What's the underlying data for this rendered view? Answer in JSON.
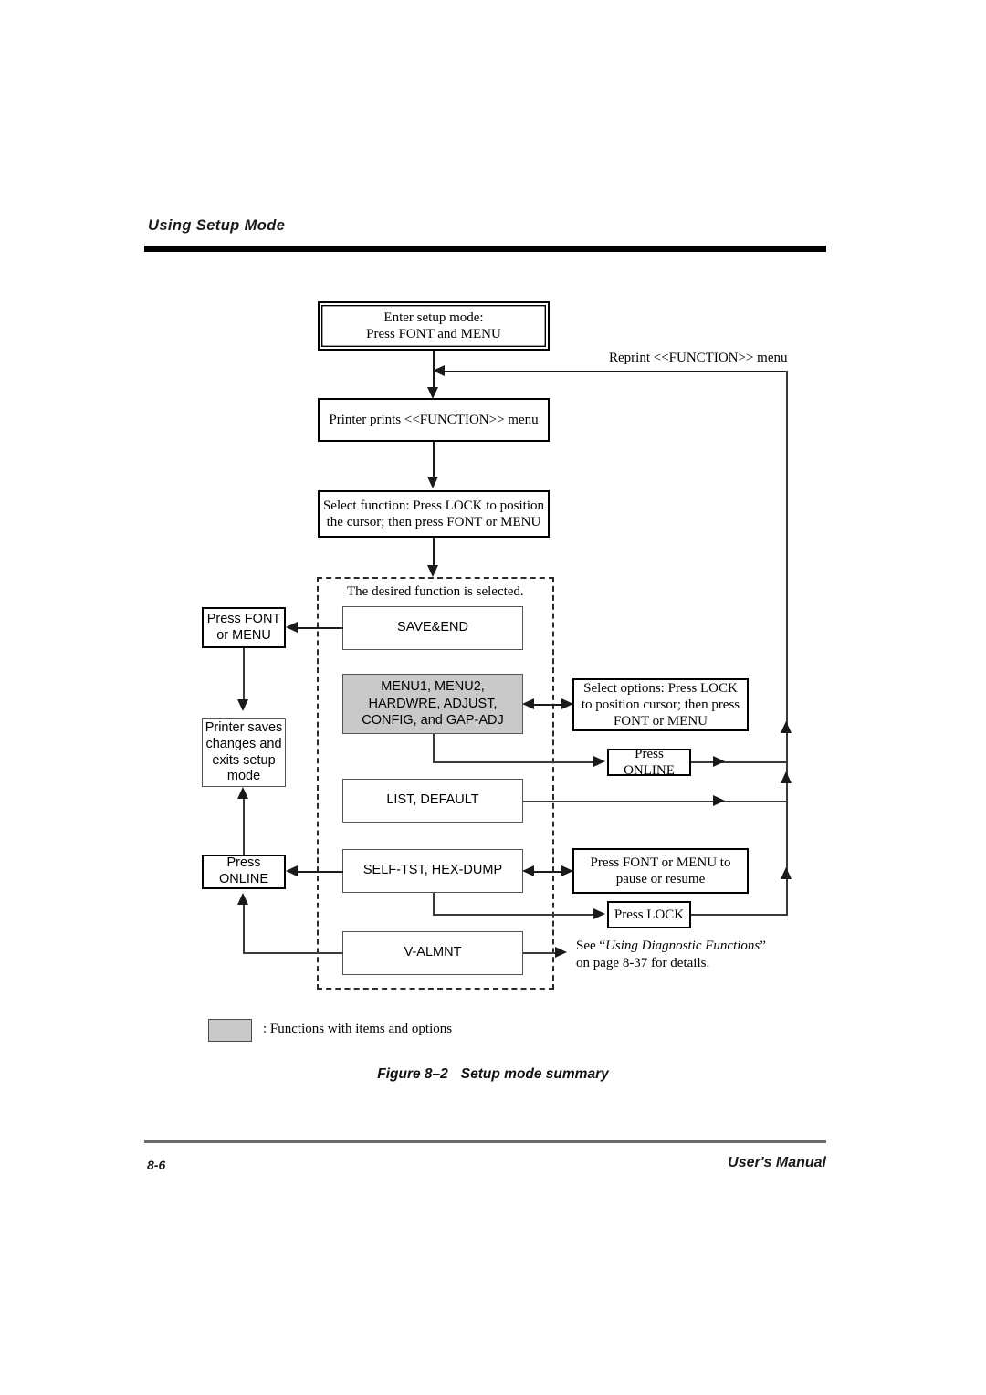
{
  "header": {
    "title": "Using Setup Mode"
  },
  "footer": {
    "page_number": "8-6",
    "manual_label": "User's Manual"
  },
  "caption": {
    "figure_number": "Figure 8–2",
    "figure_title": "Setup mode summary"
  },
  "legend": {
    "symbol": "gray-filled-box",
    "text": ": Functions with items and options"
  },
  "flowchart": {
    "enter_setup": "Enter setup mode:\nPress FONT and MENU",
    "printer_prints": "Printer prints <<FUNCTION>> menu",
    "select_function": "Select function: Press LOCK to position\nthe cursor; then press FONT or MENU",
    "reprint_label": "Reprint <<FUNCTION>> menu",
    "desired_function": "The desired function is selected.",
    "functions": [
      {
        "name": "SAVE&END",
        "style": "plain"
      },
      {
        "name": "MENU1, MENU2,\nHARDWRE, ADJUST,\nCONFIG, and GAP-ADJ",
        "style": "gray"
      },
      {
        "name": "LIST, DEFAULT",
        "style": "plain"
      },
      {
        "name": "SELF-TST, HEX-DUMP",
        "style": "plain"
      },
      {
        "name": "V-ALMNT",
        "style": "plain"
      }
    ],
    "press_font_or_menu": "Press FONT\nor MENU",
    "printer_saves": "Printer saves\nchanges and\nexits setup\nmode",
    "press_online_left": "Press ONLINE",
    "select_options": "Select options: Press LOCK\nto position cursor; then press\nFONT or MENU",
    "press_online_right": "Press ONLINE",
    "press_font_menu_pause": "Press FONT or MENU to\npause or resume",
    "press_lock": "Press LOCK",
    "diagnostic_note_prefix": "See “",
    "diagnostic_note_italic": "Using Diagnostic Functions",
    "diagnostic_note_suffix": "”",
    "diagnostic_note_line2": "on page 8-37 for details."
  },
  "colors": {
    "gray_fill": "#c9c9c9",
    "rule_black": "#000000",
    "rule_gray": "#6b6b6b",
    "line": "#3a3a3a"
  }
}
